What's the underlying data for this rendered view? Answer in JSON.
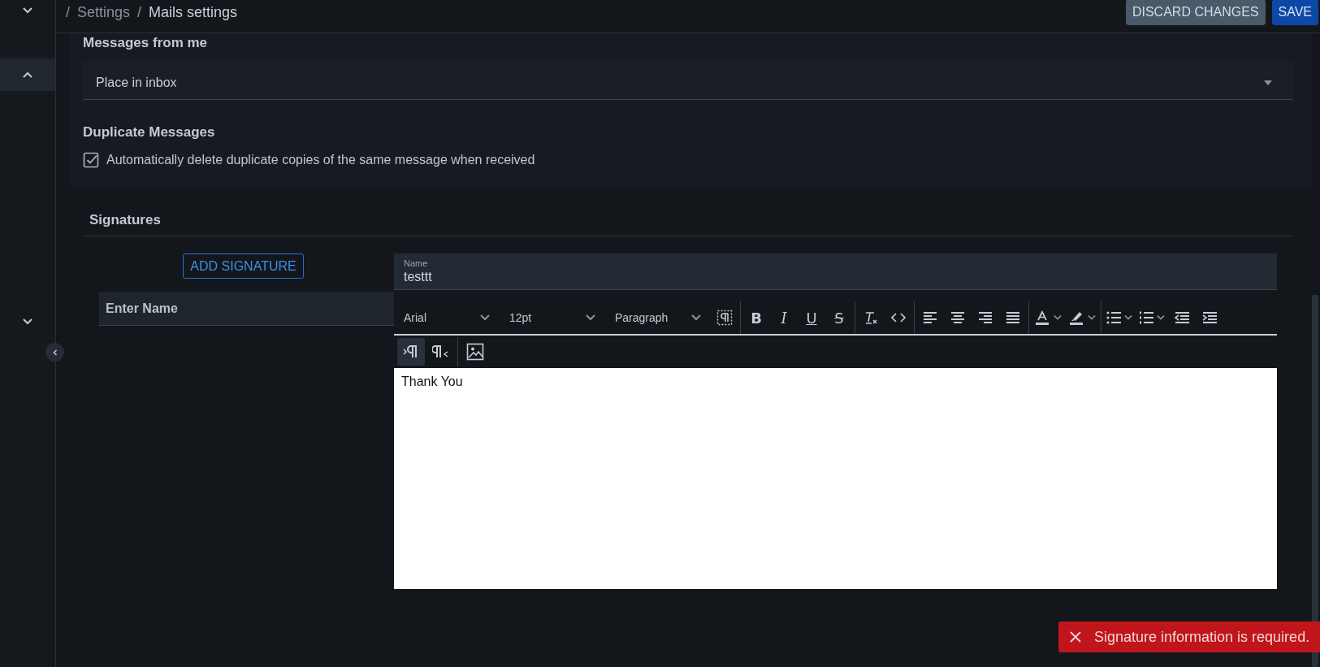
{
  "sidebar": {
    "items": [
      {
        "expanded": false,
        "selected": false
      },
      {
        "expanded": true,
        "selected": true
      },
      {
        "expanded": false,
        "selected": false
      }
    ]
  },
  "breadcrumb": [
    {
      "separator": "/",
      "label": "Settings"
    },
    {
      "separator": "/",
      "label": "Mails settings"
    }
  ],
  "actions": [
    {
      "label": "DISCARD CHANGES",
      "kind": "secondary"
    },
    {
      "label": "SAVE",
      "kind": "primary"
    }
  ],
  "messages_from_me": {
    "title": "Messages from me",
    "value": "Place in inbox"
  },
  "duplicate_messages": {
    "title": "Duplicate Messages",
    "checkbox": {
      "label": "Automatically delete duplicate copies of the same message when received",
      "checked": true
    }
  },
  "signatures": {
    "title": "Signatures",
    "add_button": "ADD SIGNATURE",
    "list": [
      {
        "name": "Enter Name",
        "selected": true
      }
    ],
    "name_field": {
      "label": "Name",
      "value": "testtt"
    },
    "editor": {
      "selects": [
        "Arial",
        "12pt",
        "Paragraph"
      ],
      "format_buttons": [
        {
          "label": "B",
          "kind": "bold"
        },
        {
          "label": "I",
          "kind": "italic"
        },
        {
          "label": "U",
          "kind": "underline"
        },
        {
          "label": "S",
          "kind": "strike"
        }
      ],
      "direction_buttons": [
        {
          "kind": "ltr",
          "selected": true
        },
        {
          "kind": "rtl",
          "selected": false
        }
      ],
      "content": "Thank You"
    }
  },
  "toast": {
    "message": "Signature information is required."
  }
}
